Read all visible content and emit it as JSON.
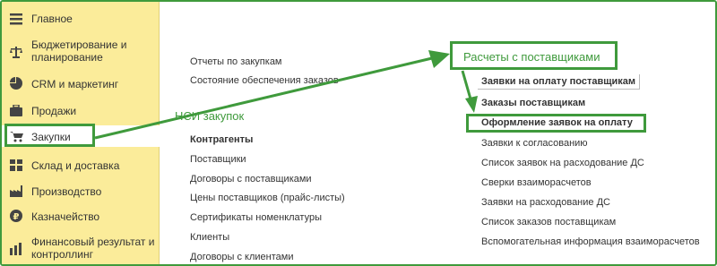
{
  "sidebar": {
    "items": [
      {
        "label": "Главное",
        "icon": "menu-list-icon"
      },
      {
        "label": "Бюджетирование и планирование",
        "icon": "scales-icon"
      },
      {
        "label": "CRM и маркетинг",
        "icon": "pie-chart-icon"
      },
      {
        "label": "Продажи",
        "icon": "briefcase-icon"
      },
      {
        "label": "Закупки",
        "icon": "shopping-cart-icon"
      },
      {
        "label": "Склад и доставка",
        "icon": "warehouse-grid-icon"
      },
      {
        "label": "Производство",
        "icon": "factory-icon"
      },
      {
        "label": "Казначейство",
        "icon": "coin-icon"
      },
      {
        "label": "Финансовый результат и контроллинг",
        "icon": "bar-chart-icon"
      }
    ]
  },
  "reports": {
    "items": [
      "Отчеты по закупкам",
      "Состояние обеспечения заказов"
    ]
  },
  "nsi": {
    "title": "НСИ закупок",
    "items": [
      {
        "label": "Контрагенты",
        "bold": true
      },
      {
        "label": "Поставщики"
      },
      {
        "label": "Договоры с поставщиками"
      },
      {
        "label": "Цены поставщиков (прайс-листы)"
      },
      {
        "label": "Сертификаты номенклатуры"
      },
      {
        "label": "Клиенты"
      },
      {
        "label": "Договоры с клиентами"
      }
    ]
  },
  "settlements": {
    "title": "Расчеты с поставщиками",
    "items": [
      {
        "label": "Заявки на оплату поставщикам",
        "bold": true
      },
      {
        "label": "Заказы поставщикам",
        "bold": true
      },
      {
        "label": "Оформление заявок на оплату",
        "bold": true
      },
      {
        "label": "Заявки к согласованию"
      },
      {
        "label": "Список заявок на расходование ДС"
      },
      {
        "label": "Сверки взаиморасчетов"
      },
      {
        "label": "Заявки на расходование ДС"
      },
      {
        "label": "Список заказов поставщикам"
      },
      {
        "label": "Вспомогательная информация взаиморасчетов"
      }
    ]
  },
  "colors": {
    "accent": "#3f9a3c",
    "sidebar_bg": "#fbec9a"
  }
}
